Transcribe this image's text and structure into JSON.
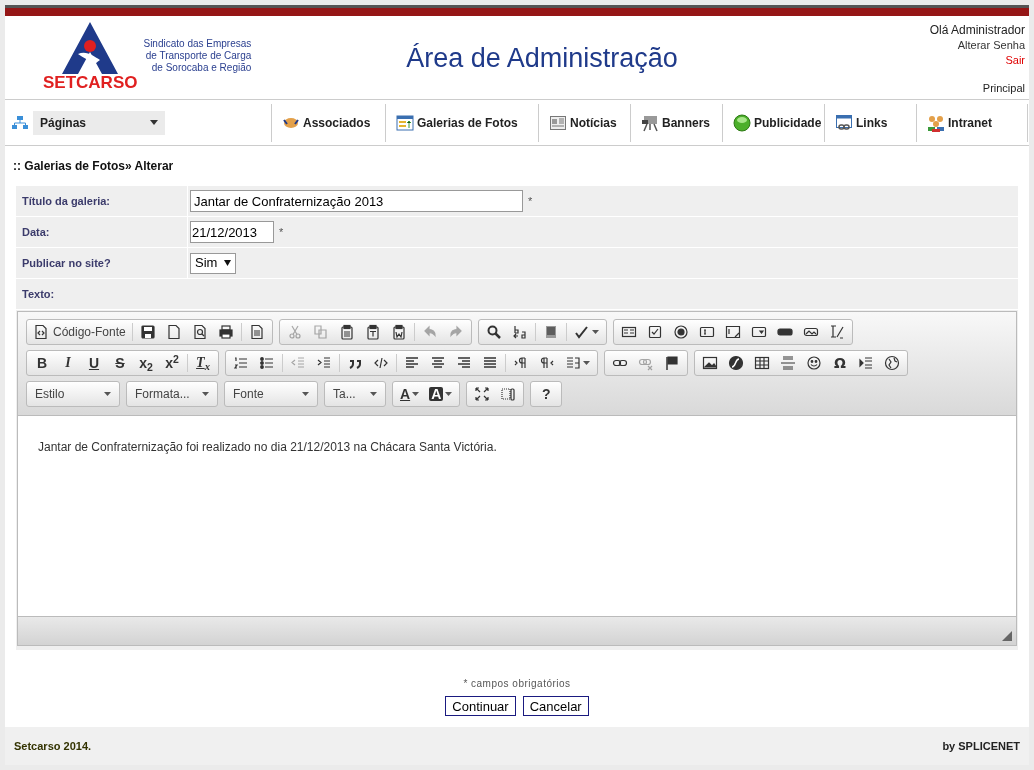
{
  "header": {
    "logo": {
      "wordmark": "SETCARSO",
      "tagline": [
        "Sindicato das Empresas",
        "de Transporte de Carga",
        "de Sorocaba e Região"
      ]
    },
    "title": "Área de Administração",
    "user": {
      "greeting": "Olá Administrador",
      "change_password": "Alterar Senha",
      "logout": "Sair",
      "home": "Principal"
    }
  },
  "nav": {
    "pages_dropdown": "Páginas",
    "items": [
      "Associados",
      "Galerias de Fotos",
      "Notícias",
      "Banners",
      "Publicidade",
      "Links",
      "Intranet"
    ]
  },
  "breadcrumb": ":: Galerias de Fotos» Alterar",
  "form": {
    "fields": [
      {
        "kind": "text",
        "label": "Título da galeria:",
        "value": "Jantar de Confraternização 2013",
        "mark": "*"
      },
      {
        "kind": "date",
        "label": "Data:",
        "value": "21/12/2013",
        "mark": "*"
      },
      {
        "kind": "select",
        "label": "Publicar no site?",
        "value": "Sim"
      },
      {
        "kind": "editor",
        "label": "Texto:"
      }
    ]
  },
  "editor": {
    "toolbar": [
      [
        {
          "items": [
            {
              "kind": "source",
              "label": "Código-Fonte",
              "disabled": false
            },
            {
              "kind": "separator"
            },
            {
              "kind": "icon",
              "disabled": false
            },
            {
              "kind": "icon",
              "disabled": false
            },
            {
              "kind": "icon",
              "disabled": false
            },
            {
              "kind": "icon",
              "disabled": false
            },
            {
              "kind": "separator"
            },
            {
              "kind": "icon",
              "disabled": false
            }
          ]
        },
        {
          "items": [
            {
              "kind": "icon",
              "disabled": true
            },
            {
              "kind": "icon",
              "disabled": true
            },
            {
              "kind": "icon",
              "disabled": false
            },
            {
              "kind": "icon",
              "disabled": false
            },
            {
              "kind": "icon",
              "disabled": false
            },
            {
              "kind": "separator"
            },
            {
              "kind": "icon",
              "disabled": true
            },
            {
              "kind": "icon",
              "disabled": true
            }
          ]
        },
        {
          "items": [
            {
              "kind": "icon",
              "disabled": false
            },
            {
              "kind": "icon",
              "disabled": false
            },
            {
              "kind": "separator"
            },
            {
              "kind": "icon",
              "disabled": false
            },
            {
              "kind": "separator"
            },
            {
              "kind": "icon",
              "disabled": false,
              "caret": true
            }
          ]
        },
        {
          "items": [
            {
              "kind": "icon",
              "disabled": false
            },
            {
              "kind": "icon",
              "disabled": false
            },
            {
              "kind": "icon",
              "disabled": false
            },
            {
              "kind": "icon",
              "disabled": false
            },
            {
              "kind": "icon",
              "disabled": false
            },
            {
              "kind": "icon",
              "disabled": false
            },
            {
              "kind": "icon",
              "disabled": false
            },
            {
              "kind": "icon",
              "disabled": false
            },
            {
              "kind": "icon",
              "disabled": false
            }
          ]
        }
      ],
      [
        {
          "items": [
            {
              "kind": "glyph",
              "glyph": "B",
              "disabled": false
            },
            {
              "kind": "glyph",
              "glyph": "I",
              "disabled": false
            },
            {
              "kind": "glyph",
              "glyph": "U",
              "disabled": false
            },
            {
              "kind": "glyph",
              "glyph": "S",
              "disabled": false
            },
            {
              "kind": "glyph",
              "glyph": "x$_{2}$",
              "disabled": false
            },
            {
              "kind": "glyph",
              "glyph": "x$^{2}$",
              "disabled": false
            },
            {
              "kind": "separator"
            },
            {
              "kind": "glyph",
              "glyph": "T$_{x}$",
              "disabled": false
            }
          ]
        },
        {
          "items": [
            {
              "kind": "icon",
              "disabled": false
            },
            {
              "kind": "icon",
              "disabled": false
            },
            {
              "kind": "separator"
            },
            {
              "kind": "icon",
              "disabled": true
            },
            {
              "kind": "icon",
              "disabled": false
            },
            {
              "kind": "separator"
            },
            {
              "kind": "icon",
              "disabled": false
            },
            {
              "kind": "icon",
              "disabled": false
            },
            {
              "kind": "separator"
            },
            {
              "kind": "icon",
              "disabled": false
            },
            {
              "kind": "icon",
              "disabled": false
            },
            {
              "kind": "icon",
              "disabled": false
            },
            {
              "kind": "icon",
              "disabled": false
            },
            {
              "kind": "separator"
            },
            {
              "kind": "icon",
              "disabled": false
            },
            {
              "kind": "icon",
              "disabled": false
            },
            {
              "kind": "icon",
              "disabled": false,
              "caret": true
            }
          ]
        },
        {
          "items": [
            {
              "kind": "icon",
              "disabled": false
            },
            {
              "kind": "icon",
              "disabled": true
            },
            {
              "kind": "icon",
              "disabled": false
            }
          ]
        },
        {
          "items": [
            {
              "kind": "icon",
              "disabled": false
            },
            {
              "kind": "icon",
              "disabled": false
            },
            {
              "kind": "icon",
              "disabled": false
            },
            {
              "kind": "icon",
              "disabled": false
            },
            {
              "kind": "icon",
              "disabled": false
            },
            {
              "kind": "glyph",
              "glyph": "Ω",
              "disabled": false
            },
            {
              "kind": "icon",
              "disabled": false
            },
            {
              "kind": "icon",
              "disabled": false
            }
          ]
        }
      ],
      [
        {
          "kind": "combo",
          "label": "Estilo"
        },
        {
          "kind": "combo",
          "label": "Formata..."
        },
        {
          "kind": "combo",
          "label": "Fonte"
        },
        {
          "kind": "combo",
          "label": "Ta..."
        },
        {
          "items": [
            {
              "kind": "glyph",
              "glyph": "A",
              "disabled": false,
              "caret": true
            },
            {
              "kind": "glyph",
              "glyph": "A",
              "disabled": false,
              "caret": true
            }
          ]
        },
        {
          "items": [
            {
              "kind": "icon",
              "disabled": false
            },
            {
              "kind": "icon",
              "disabled": false
            }
          ]
        },
        {
          "items": [
            {
              "kind": "glyph",
              "glyph": "?",
              "disabled": false
            }
          ]
        }
      ]
    ],
    "content": "Jantar de Confraternização foi realizado no dia 21/12/2013 na Chácara Santa Victória."
  },
  "required_note": "* campos obrigatórios",
  "buttons": [
    "Continuar",
    "Cancelar"
  ],
  "footer": {
    "left": "Setcarso 2014.",
    "right": "by SPLICENET"
  }
}
